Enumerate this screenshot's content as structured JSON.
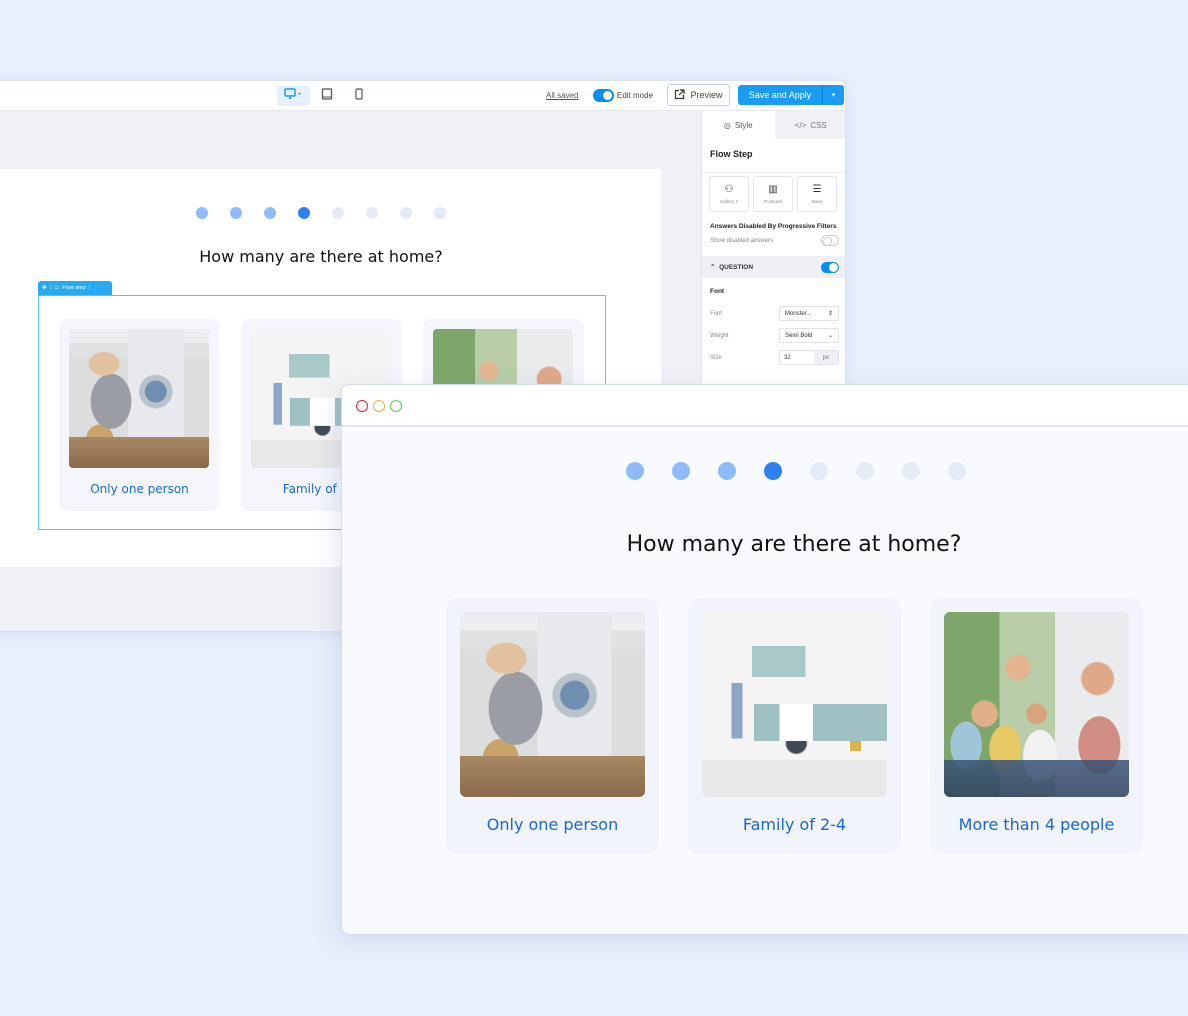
{
  "editor": {
    "toolbar": {
      "devices": [
        {
          "name": "desktop",
          "icon": "monitor-icon",
          "active": true
        },
        {
          "name": "tablet",
          "icon": "tablet-icon",
          "active": false
        },
        {
          "name": "mobile",
          "icon": "phone-icon",
          "active": false
        }
      ],
      "save_status": "All saved",
      "edit_mode_label": "Edit mode",
      "edit_mode_on": true,
      "preview_label": "Preview",
      "save_apply_label": "Save and Apply",
      "accent_color": "#1a9cf5"
    },
    "canvas": {
      "progress": {
        "total": 8,
        "current": 4
      },
      "question": "How many are there at home?",
      "flow_step_tag": "Flow step",
      "answers": [
        {
          "label": "Only one person",
          "image": "woman-doing-laundry"
        },
        {
          "label": "Family of 2-4",
          "image": "family-in-laundry-room"
        },
        {
          "label": "More than 4 people",
          "image": "large-family-on-sofa"
        }
      ]
    },
    "side_panel": {
      "tabs": [
        {
          "label": "Style",
          "icon": "palette-icon",
          "active": true
        },
        {
          "label": "CSS",
          "icon": "code-icon",
          "active": false
        }
      ],
      "section_title": "Flow Step",
      "layouts": [
        {
          "label": "Gallery II",
          "icon": "gallery-icon"
        },
        {
          "label": "Postcard",
          "icon": "postcard-icon"
        },
        {
          "label": "Stack",
          "icon": "stack-icon"
        }
      ],
      "answers_disabled_title": "Answers Disabled By Progressive Filters",
      "show_disabled_label": "Show disabled answers",
      "show_disabled_on": false,
      "question_section": "QUESTION",
      "question_enabled": true,
      "font_heading": "Font",
      "fields": {
        "font_label": "Font",
        "font_value": "Monster...",
        "weight_label": "Weight",
        "weight_value": "Semi Bold",
        "size_label": "Size",
        "size_value": "32",
        "size_unit": "px"
      }
    }
  },
  "preview": {
    "progress": {
      "total": 8,
      "current": 4
    },
    "question": "How many are there at home?",
    "answers": [
      {
        "label": "Only one person",
        "image": "woman-doing-laundry"
      },
      {
        "label": "Family of 2-4",
        "image": "family-in-laundry-room"
      },
      {
        "label": "More than 4 people",
        "image": "large-family-on-sofa"
      }
    ],
    "colors": {
      "dot_done": "#8fbcf9",
      "dot_current": "#2f80f3",
      "dot_pending": "#e5ebf7",
      "answer_text": "#1a66d6"
    }
  }
}
